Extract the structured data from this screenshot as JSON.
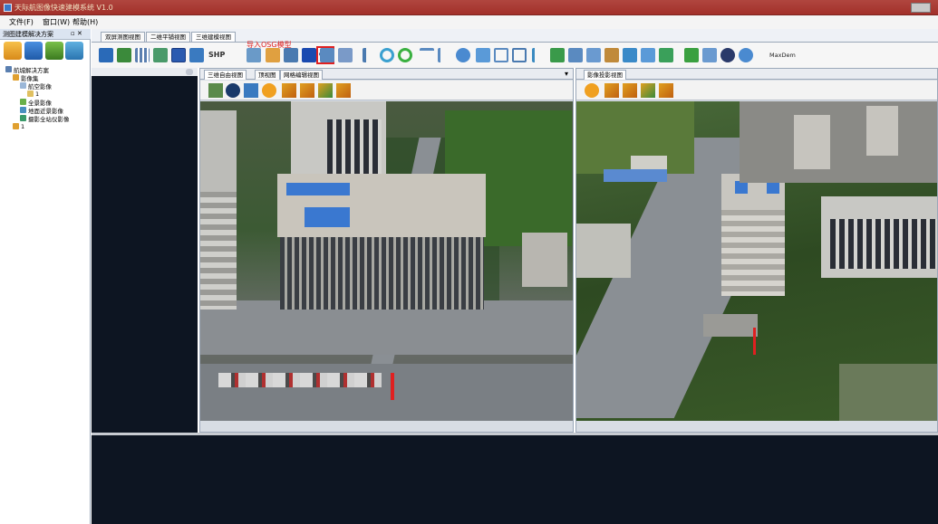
{
  "window": {
    "title": "天际航图像快速建模系统 V1.0"
  },
  "menu": {
    "items": [
      "文件(F)",
      "窗口(W)",
      "帮助(H)"
    ]
  },
  "left_panel": {
    "header": "测图建模解决方案",
    "header_controls": "▫ ✕",
    "tree": [
      {
        "label": "航城解决方案",
        "level": 0
      },
      {
        "label": "影像集",
        "level": 1
      },
      {
        "label": "航空影像",
        "level": 2
      },
      {
        "label": "1",
        "level": 3
      },
      {
        "label": "全景影像",
        "level": 2
      },
      {
        "label": "地面近景影像",
        "level": 2
      },
      {
        "label": "摄影全站仪影像",
        "level": 2
      },
      {
        "label": "1",
        "level": 1
      }
    ]
  },
  "view_tabs": [
    "双屏测图视图",
    "二维平铺视图",
    "三维建模视图"
  ],
  "toolbar": {
    "shp_label": "SHP",
    "osc_label": "OSG",
    "osc_note": "导入OSG模型",
    "maxdem_label": "MaxDem"
  },
  "left_view": {
    "tabs": [
      "三维自由视图",
      "顶视图",
      "网格编辑视图"
    ],
    "dropdown": "▾"
  },
  "right_view": {
    "tabs": [
      "影像投影视图"
    ]
  },
  "colors": {
    "title_bar": "#a2302a",
    "osc_highlight": "#e02020",
    "dark_bg": "#0d1522"
  }
}
